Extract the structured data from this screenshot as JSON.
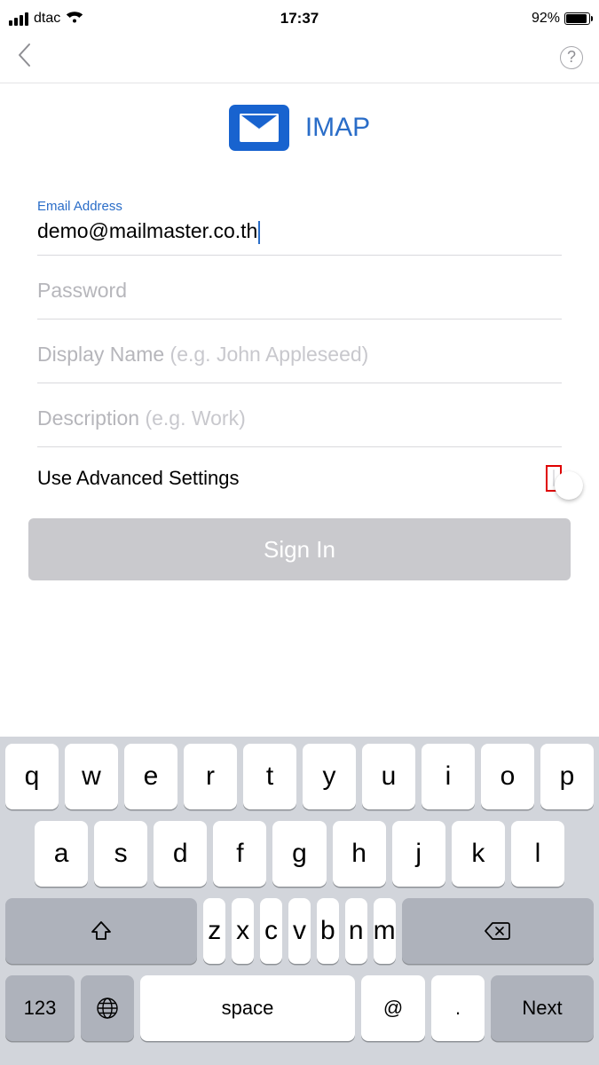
{
  "status_bar": {
    "carrier": "dtac",
    "time": "17:37",
    "battery_pct": "92%"
  },
  "provider": {
    "title": "IMAP"
  },
  "form": {
    "email_label": "Email Address",
    "email_value": "demo@mailmaster.co.th",
    "password_placeholder": "Password",
    "display_name_label": "Display Name",
    "display_name_hint": "(e.g. John Appleseed)",
    "description_label": "Description",
    "description_hint": "(e.g. Work)",
    "advanced_toggle_label": "Use Advanced Settings",
    "advanced_toggle_on": false,
    "signin_label": "Sign In"
  },
  "keyboard": {
    "row1": [
      "q",
      "w",
      "e",
      "r",
      "t",
      "y",
      "u",
      "i",
      "o",
      "p"
    ],
    "row2": [
      "a",
      "s",
      "d",
      "f",
      "g",
      "h",
      "j",
      "k",
      "l"
    ],
    "row3": [
      "z",
      "x",
      "c",
      "v",
      "b",
      "n",
      "m"
    ],
    "numkey": "123",
    "space": "space",
    "at": "@",
    "dot": ".",
    "next": "Next"
  },
  "help_glyph": "?"
}
